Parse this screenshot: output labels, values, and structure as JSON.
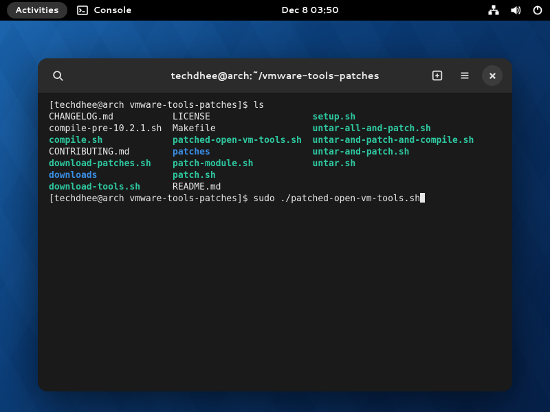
{
  "topbar": {
    "activities": "Activities",
    "app_name": "Console",
    "clock": "Dec 8  03:50"
  },
  "window": {
    "title": "techdhee@arch:~/vmware-tools-patches"
  },
  "terminal": {
    "prompt1": "[techdhee@arch vmware-tools-patches]$ ",
    "cmd1": "ls",
    "prompt2": "[techdhee@arch vmware-tools-patches]$ ",
    "cmd2": "sudo ./patched-open-vm-tools.sh",
    "ls": {
      "col1": [
        {
          "t": "CHANGELOG.md",
          "c": "plain"
        },
        {
          "t": "compile-pre-10.2.1.sh",
          "c": "plain"
        },
        {
          "t": "compile.sh",
          "c": "green"
        },
        {
          "t": "CONTRIBUTING.md",
          "c": "plain"
        },
        {
          "t": "download-patches.sh",
          "c": "green"
        },
        {
          "t": "downloads",
          "c": "blue"
        },
        {
          "t": "download-tools.sh",
          "c": "green"
        }
      ],
      "col2": [
        {
          "t": "LICENSE",
          "c": "plain"
        },
        {
          "t": "Makefile",
          "c": "plain"
        },
        {
          "t": "patched-open-vm-tools.sh",
          "c": "green"
        },
        {
          "t": "patches",
          "c": "blue"
        },
        {
          "t": "patch-module.sh",
          "c": "green"
        },
        {
          "t": "patch.sh",
          "c": "green"
        },
        {
          "t": "README.md",
          "c": "plain"
        }
      ],
      "col3": [
        {
          "t": "setup.sh",
          "c": "green"
        },
        {
          "t": "untar-all-and-patch.sh",
          "c": "green"
        },
        {
          "t": "untar-and-patch-and-compile.sh",
          "c": "green"
        },
        {
          "t": "untar-and-patch.sh",
          "c": "green"
        },
        {
          "t": "untar.sh",
          "c": "green"
        },
        {
          "t": "",
          "c": "plain"
        },
        {
          "t": "",
          "c": "plain"
        }
      ],
      "col1_width": 23,
      "col2_width": 26
    }
  }
}
